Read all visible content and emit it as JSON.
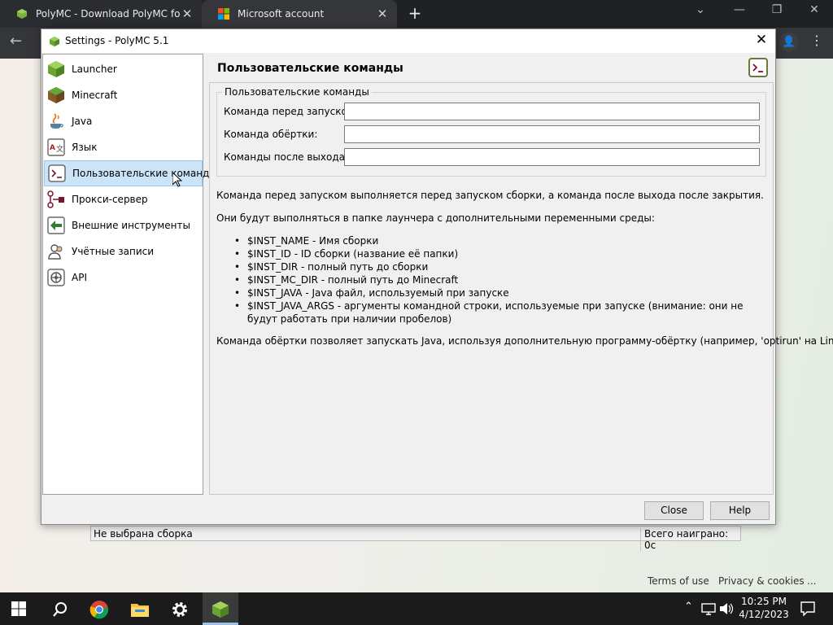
{
  "browser": {
    "tabs": [
      {
        "title": "PolyMC - Download PolyMC for",
        "close": "✕"
      },
      {
        "title": "Microsoft account",
        "close": "✕"
      }
    ],
    "new_tab": "+",
    "win_controls": {
      "chevron": "⌄",
      "minimize": "—",
      "restore": "❐",
      "close": "✕"
    }
  },
  "page": {
    "footer": {
      "terms": "Terms of use",
      "privacy": "Privacy & cookies",
      "more": "..."
    }
  },
  "statusbar": {
    "instance": "Не выбрана сборка",
    "playtime": "Всего наиграно: 0с"
  },
  "dialog": {
    "title": "Settings - PolyMC 5.1",
    "close": "✕",
    "sidebar": {
      "items": [
        {
          "label": "Launcher",
          "icon": "polymc-cube-icon"
        },
        {
          "label": "Minecraft",
          "icon": "grass-block-icon"
        },
        {
          "label": "Java",
          "icon": "java-cup-icon"
        },
        {
          "label": "Язык",
          "icon": "language-icon"
        },
        {
          "label": "Пользовательские команды",
          "icon": "terminal-icon",
          "selected": true
        },
        {
          "label": "Прокси-сервер",
          "icon": "proxy-icon"
        },
        {
          "label": "Внешние инструменты",
          "icon": "external-tools-icon"
        },
        {
          "label": "Учётные записи",
          "icon": "accounts-icon"
        },
        {
          "label": "API",
          "icon": "api-icon"
        }
      ]
    },
    "content": {
      "heading": "Пользовательские команды",
      "group_title": "Пользовательские команды",
      "fields": {
        "pre_launch": {
          "label": "Команда перед запуском:",
          "value": ""
        },
        "wrapper": {
          "label": "Команда обёртки:",
          "value": ""
        },
        "post_exit": {
          "label": "Команды после выхода:",
          "value": ""
        }
      },
      "description_1": "Команда перед запуском выполняется перед запуском сборки, а команда после выхода после закрытия.",
      "description_2": "Они будут выполняться в папке лаунчера с дополнительными переменными среды:",
      "variables": [
        "$INST_NAME - Имя сборки",
        "$INST_ID - ID сборки (название её папки)",
        "$INST_DIR - полный путь до сборки",
        "$INST_MC_DIR - полный путь до Minecraft",
        "$INST_JAVA - Java файл, используемый при запуске",
        "$INST_JAVA_ARGS - аргументы командной строки, используемые при запуске (внимание: они не будут работать при наличии пробелов)"
      ],
      "description_3": "Команда обёртки позволяет запускать Java, используя дополнительную программу-обёртку (например, 'optirun' на Linux)"
    },
    "buttons": {
      "close": "Close",
      "help": "Help"
    }
  },
  "taskbar": {
    "time": "10:25 PM",
    "date": "4/12/2023"
  }
}
